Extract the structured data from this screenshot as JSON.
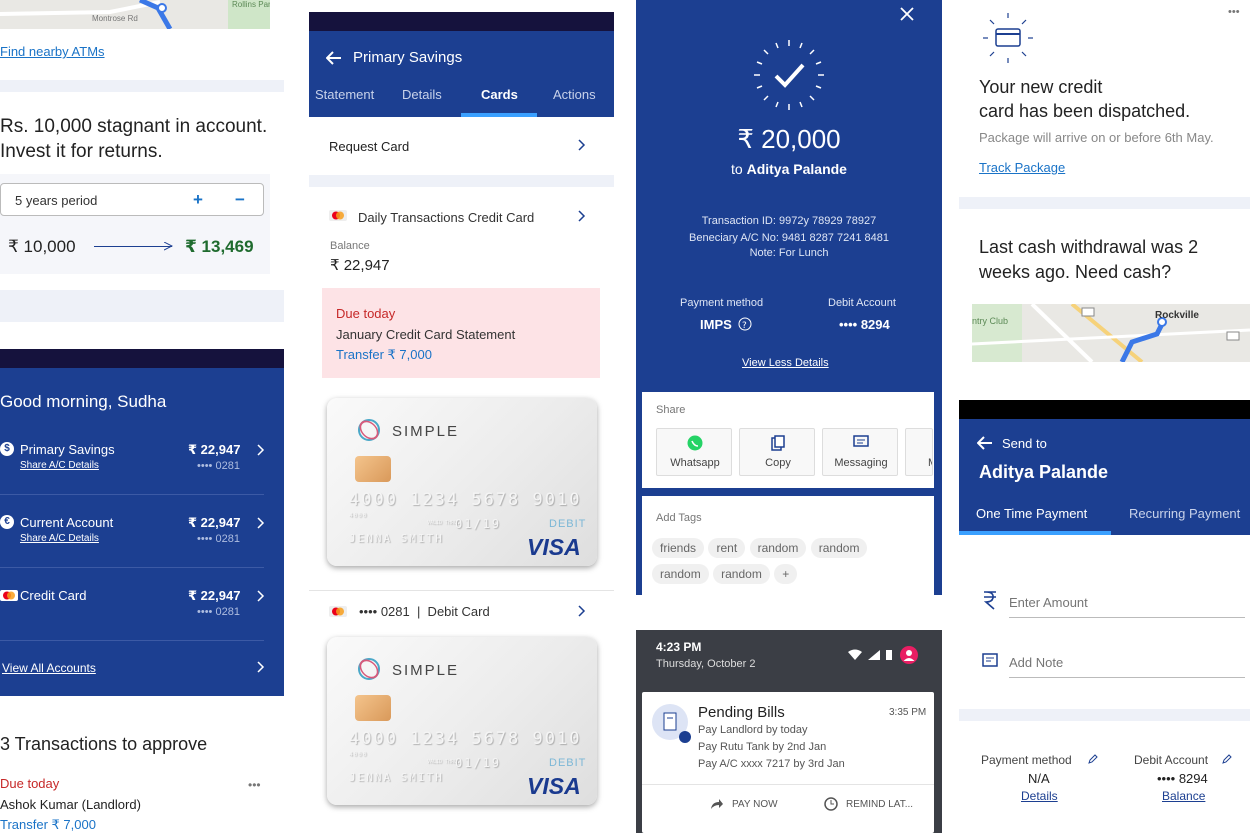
{
  "col1": {
    "atm_link": "Find nearby ATMs",
    "map_label": "Montrose Rd",
    "map_label2": "Rollins Park",
    "stagnant_line1": "Rs. 10,000 stagnant in account.",
    "stagnant_line2": "Invest it for returns.",
    "period_value": "5 years period",
    "plus": "+",
    "minus": "−",
    "amount_from": "₹ 10,000",
    "amount_to": "₹ 13,469",
    "greeting": "Good morning, Sudha",
    "accounts": [
      {
        "icon": "$",
        "name": "Primary Savings",
        "share": "Share A/C Details",
        "amount": "₹ 22,947",
        "number": "•••• 0281"
      },
      {
        "icon": "€",
        "name": "Current Account",
        "share": "Share A/C Details",
        "amount": "₹ 22,947",
        "number": "•••• 0281"
      },
      {
        "icon": "",
        "name": "Credit Card",
        "share": "",
        "amount": "₹ 22,947",
        "number": "•••• 0281"
      }
    ],
    "view_all": "View All Accounts",
    "transactions_title": "3 Transactions to approve",
    "due_today": "Due today",
    "payee": "Ashok Kumar (Landlord)",
    "transfer": "Transfer ₹ 7,000",
    "more": "•••"
  },
  "col2": {
    "title": "Primary Savings",
    "tabs": [
      "Statement",
      "Details",
      "Cards",
      "Actions"
    ],
    "active_tab": "Cards",
    "request_card": "Request Card",
    "credit_card_name": "Daily Transactions Credit Card",
    "balance_label": "Balance",
    "balance_value": "₹ 22,947",
    "due_today": "Due today",
    "statement": "January Credit Card Statement",
    "transfer": "Transfer ₹ 7,000",
    "brand": "SIMPLE",
    "card_number": "4000 1234 5678 9010",
    "card_small": "4000",
    "valid": "VALID THRU",
    "expiry": "01/19",
    "holder": "JENNA SMITH",
    "debit": "DEBIT",
    "visa": "VISA",
    "debit_card_label": "•••• 0281  |  Debit Card"
  },
  "col3": {
    "amount": "₹ 20,000",
    "to": "to",
    "recipient": "Aditya Palande",
    "txn_id": "Transaction ID: 9972y 78929 78927",
    "beneficiary": "Beneciary A/C No: 9481 8287 7241 8481",
    "note": "Note:  For Lunch",
    "payment_method_label": "Payment method",
    "payment_method": "IMPS",
    "debit_account_label": "Debit Account",
    "debit_account": "•••• 8294",
    "view_less": "View Less Details",
    "share_label": "Share",
    "share_options": [
      "Whatsapp",
      "Copy",
      "Messaging",
      "M"
    ],
    "add_tags": "Add Tags",
    "tags_row1": [
      "friends",
      "rent",
      "random",
      "random"
    ],
    "tags_row2": [
      "random",
      "random",
      "+"
    ],
    "time": "4:23 PM",
    "date": "Thursday, October 2",
    "notif_title": "Pending Bills",
    "notif_time": "3:35 PM",
    "notif_lines": [
      "Pay Landlord by today",
      "Pay Rutu Tank by 2nd Jan",
      "Pay A/C xxxx 7217 by 3rd Jan"
    ],
    "pay_now": "PAY NOW",
    "remind": "REMIND LAT..."
  },
  "col4": {
    "more": "•••",
    "dispatched_line1": "Your new credit",
    "dispatched_line2": "card has been dispatched.",
    "package_note": "Package will arrive on or before 6th May.",
    "track": "Track Package",
    "cash_line1": "Last cash withdrawal was 2",
    "cash_line2": "weeks ago. Need cash?",
    "map_label_rockville": "Rockville",
    "map_label_club": "ntry Club",
    "send_to": "Send to",
    "recipient": "Aditya Palande",
    "tabs": [
      "One Time Payment",
      "Recurring Payment"
    ],
    "amount_placeholder": "Enter Amount",
    "note_placeholder": "Add Note",
    "payment_method_label": "Payment method",
    "payment_method_value": "N/A",
    "details_link": "Details",
    "debit_account_label": "Debit Account",
    "debit_account_value": "•••• 8294",
    "balance_link": "Balance"
  },
  "colors": {
    "navy": "#1c3f91",
    "dark_header": "#15123d",
    "link": "#1a73c7",
    "due_red": "#c62828",
    "success_green": "#1f6b2e",
    "due_bg": "#fde3e6"
  }
}
